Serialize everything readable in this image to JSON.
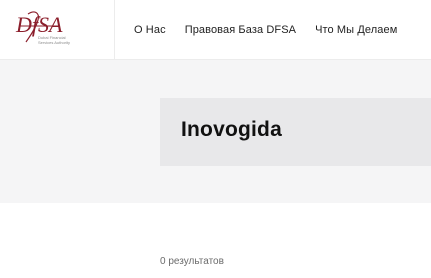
{
  "header": {
    "logo": {
      "mark": "DfSA",
      "tagline_lines": [
        "Dubai Financial",
        "Services Authority"
      ],
      "brand_color": "#8b1e2b",
      "tagline_color": "#8a8a8a"
    },
    "nav": [
      {
        "label": "О Нас"
      },
      {
        "label": "Правовая База DFSA"
      },
      {
        "label": "Что Мы Делаем"
      }
    ]
  },
  "hero": {
    "title": "Inovogida"
  },
  "results": {
    "text": "0 результатов"
  },
  "colors": {
    "hero_bg": "#f5f5f6",
    "title_box_bg": "#e8e8ea",
    "title_text": "#111111",
    "nav_text": "#222222",
    "results_text": "#6b6b6b"
  }
}
